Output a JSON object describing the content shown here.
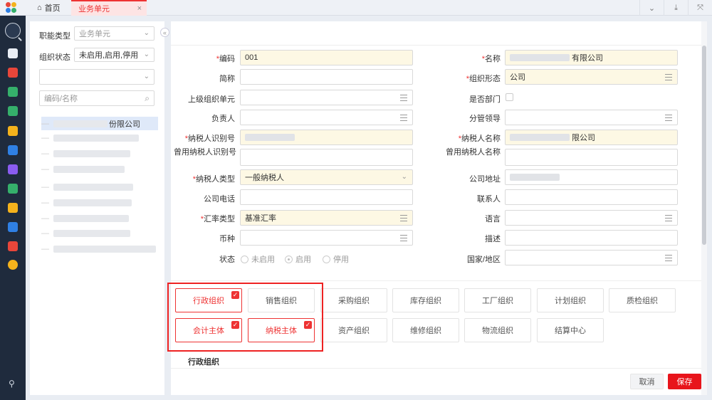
{
  "tabs": {
    "home": "首页",
    "current": "业务单元",
    "close": "×"
  },
  "top_icons": [
    "chevrons-down-icon",
    "download-icon",
    "shrink-icon"
  ],
  "colors": {
    "accent": "#e8141b",
    "nav_bg": "#1f2b3d",
    "required": "#e33333",
    "selected_tree": "#dfe9f9"
  },
  "filters": {
    "function_type_label": "职能类型",
    "function_type_value": "业务单元",
    "org_status_label": "组织状态",
    "org_status_value": "未启用,启用,停用",
    "search_placeholder": "编码/名称"
  },
  "tree": {
    "first_item_suffix": "份限公司"
  },
  "form": {
    "code_label": "编码",
    "code_value": "001",
    "name_label": "名称",
    "name_suffix": "有限公司",
    "short_label": "简称",
    "org_form_label": "组织形态",
    "org_form_value": "公司",
    "parent_label": "上级组织单元",
    "is_dept_label": "是否部门",
    "owner_label": "负责人",
    "leader_label": "分管领导",
    "taxpayer_id_label": "纳税人识别号",
    "taxpayer_name_label": "纳税人名称",
    "taxpayer_name_suffix": "限公司",
    "used_taxpayer_id_label": "曾用纳税人识别号",
    "used_taxpayer_name_label": "曾用纳税人名称",
    "taxpayer_type_label": "纳税人类型",
    "taxpayer_type_value": "一般纳税人",
    "address_label": "公司地址",
    "phone_label": "公司电话",
    "contact_label": "联系人",
    "rate_type_label": "汇率类型",
    "rate_type_value": "基准汇率",
    "lang_label": "语言",
    "currency_label": "币种",
    "desc_label": "描述",
    "status_label": "状态",
    "status_options": [
      "未启用",
      "启用",
      "停用"
    ],
    "region_label": "国家/地区"
  },
  "org_types": [
    {
      "label": "行政组织",
      "checked": true
    },
    {
      "label": "销售组织",
      "checked": false
    },
    {
      "label": "采购组织",
      "checked": false
    },
    {
      "label": "库存组织",
      "checked": false
    },
    {
      "label": "工厂组织",
      "checked": false
    },
    {
      "label": "计划组织",
      "checked": false
    },
    {
      "label": "质检组织",
      "checked": false
    },
    {
      "label": "会计主体",
      "checked": true
    },
    {
      "label": "纳税主体",
      "checked": true
    },
    {
      "label": "资产组织",
      "checked": false
    },
    {
      "label": "维修组织",
      "checked": false
    },
    {
      "label": "物流组织",
      "checked": false
    },
    {
      "label": "结算中心",
      "checked": false
    }
  ],
  "section_title": "行政组织",
  "footer": {
    "cancel": "取消",
    "save": "保存"
  }
}
